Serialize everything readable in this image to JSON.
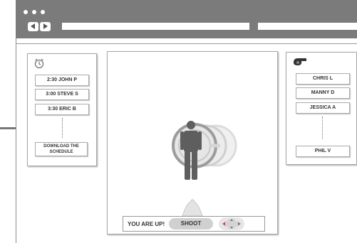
{
  "schedule": {
    "icon": "alarm-clock-icon",
    "items": [
      "2:30 JOHN P",
      "3:00 STEVE S",
      "3:30 ERIC B"
    ],
    "download_label": "DOWNLOAD THE SCHEDULE"
  },
  "players": {
    "icon": "whistle-icon",
    "items": [
      "CHRIS L",
      "MANNY D",
      "JESSICA A"
    ],
    "last_item": "PHIL V"
  },
  "controls": {
    "status_text": "YOU ARE UP!",
    "shoot_label": "SHOOT",
    "dpad_icon": "dpad-icon",
    "accent_color": "#e23a3a"
  },
  "stage": {
    "player_icon": "person-figure-icon",
    "target_icon": "target-ring-icon",
    "ball_icon": "ball-icon"
  }
}
